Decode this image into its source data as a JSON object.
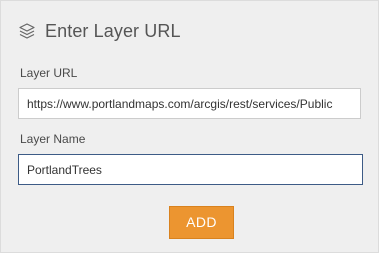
{
  "dialog": {
    "title": "Enter Layer URL",
    "title_icon": "layers-icon"
  },
  "form": {
    "layer_url": {
      "label": "Layer URL",
      "value": "https://www.portlandmaps.com/arcgis/rest/services/Public"
    },
    "layer_name": {
      "label": "Layer Name",
      "value": "PortlandTrees"
    },
    "add_button_label": "ADD"
  },
  "colors": {
    "panel_background": "#efefef",
    "accent_button": "#ec9530",
    "focused_input_border": "#3d5b86"
  }
}
